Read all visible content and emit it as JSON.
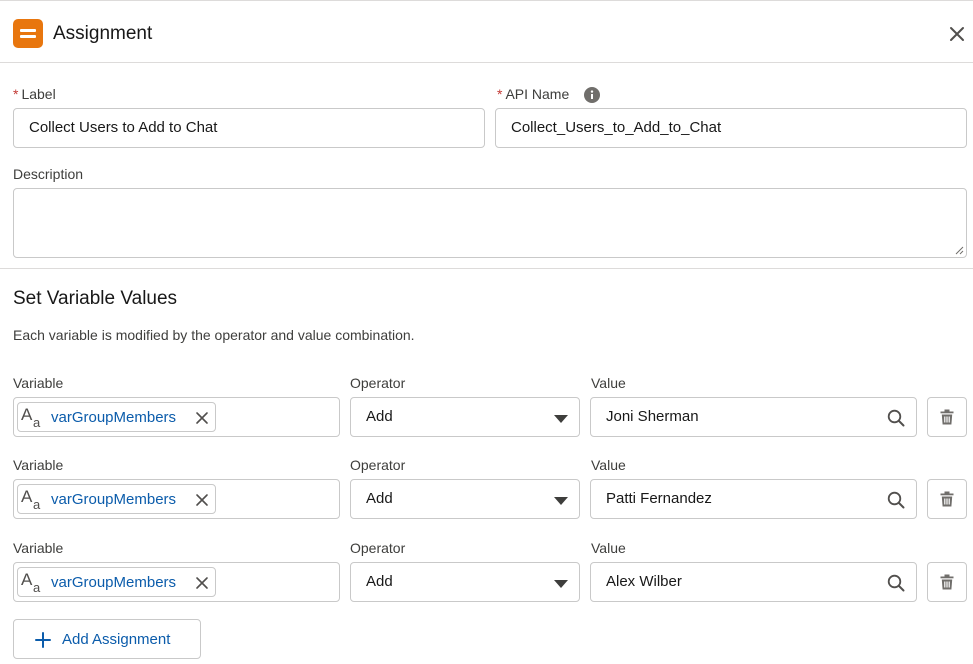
{
  "header": {
    "title": "Assignment",
    "icon": "assignment-icon",
    "icon_color": "#e8760e"
  },
  "fields": {
    "label": {
      "label": "Label",
      "value": "Collect Users to Add to Chat",
      "required": "*"
    },
    "api_name": {
      "label": "API Name",
      "value": "Collect_Users_to_Add_to_Chat",
      "required": "*"
    },
    "description": {
      "label": "Description",
      "value": ""
    }
  },
  "section": {
    "title": "Set Variable Values",
    "description": "Each variable is modified by the operator and value combination."
  },
  "assignments": [
    {
      "variable_label": "Variable",
      "operator_label": "Operator",
      "value_label": "Value",
      "variable": "varGroupMembers",
      "operator": "Add",
      "value": "Joni Sherman"
    },
    {
      "variable_label": "Variable",
      "operator_label": "Operator",
      "value_label": "Value",
      "variable": "varGroupMembers",
      "operator": "Add",
      "value": "Patti Fernandez"
    },
    {
      "variable_label": "Variable",
      "operator_label": "Operator",
      "value_label": "Value",
      "variable": "varGroupMembers",
      "operator": "Add",
      "value": "Alex Wilber"
    }
  ],
  "add_button": {
    "label": "Add Assignment"
  },
  "colors": {
    "required": "#c23934",
    "link": "#0b5cab",
    "border": "#c9c9c9"
  }
}
